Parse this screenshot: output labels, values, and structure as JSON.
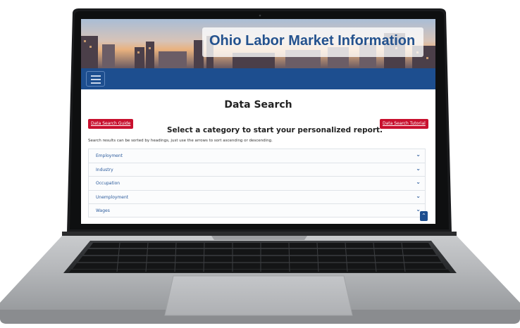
{
  "banner": {
    "title": "Ohio Labor Market Information"
  },
  "nav": {
    "menu_icon": "hamburger-menu-icon"
  },
  "main": {
    "page_title": "Data Search",
    "guide_button": "Data Search Guide",
    "tutorial_button": "Data Search Tutorial",
    "subheading": "Select a category to start your personalized report.",
    "helper_text": "Search results can be sorted by headings, just use the arrows to sort ascending or descending.",
    "categories": [
      {
        "label": "Employment"
      },
      {
        "label": "Industry"
      },
      {
        "label": "Occupation"
      },
      {
        "label": "Unemployment"
      },
      {
        "label": "Wages"
      }
    ],
    "chevron_icon": "chevron-down-icon",
    "back_to_top_icon": "chevron-up-icon"
  },
  "colors": {
    "nav_blue": "#1d4e8f",
    "title_blue": "#24528e",
    "button_red": "#c8102e",
    "link_blue": "#2a5a9c"
  }
}
